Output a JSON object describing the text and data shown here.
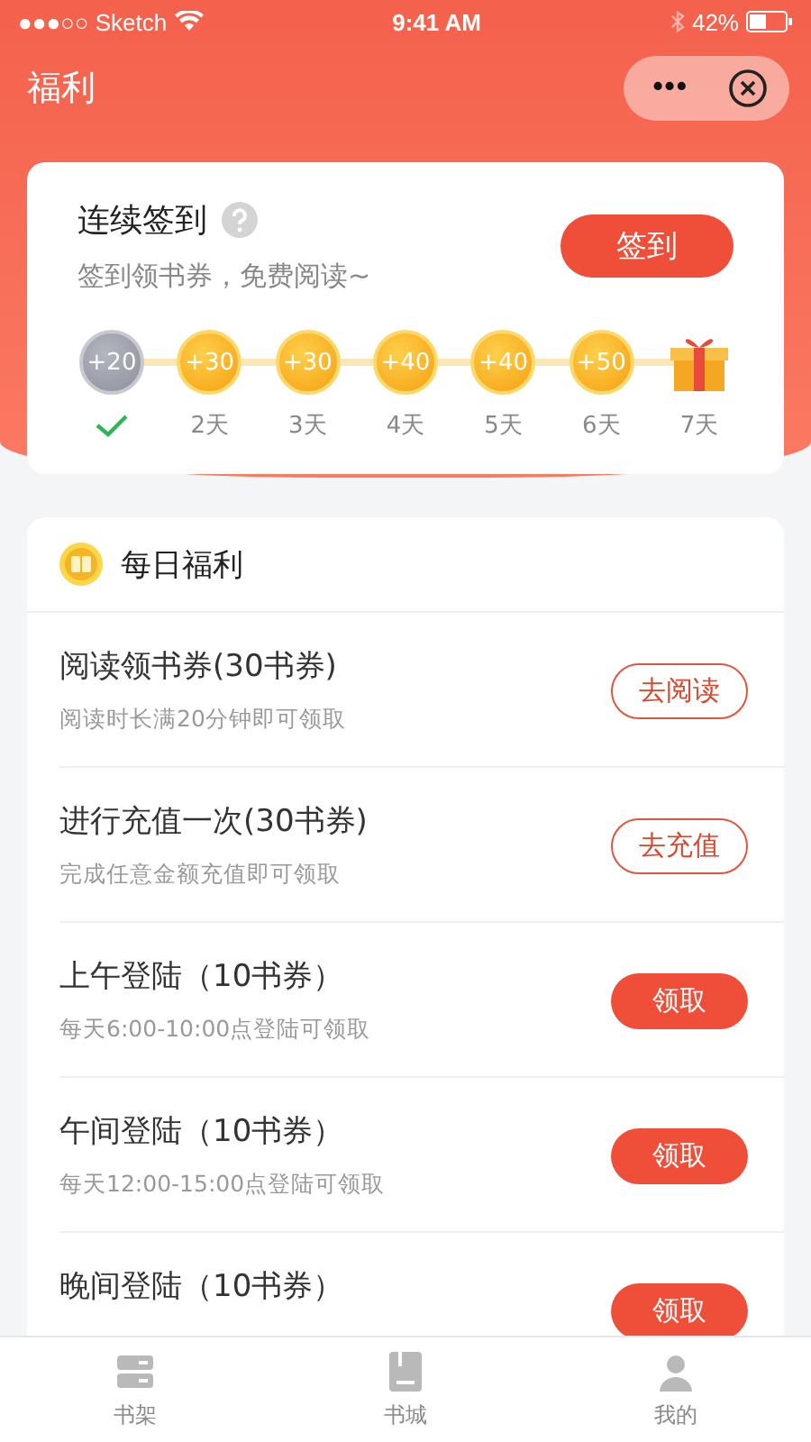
{
  "status_bar": {
    "carrier": "●●●○○ Sketch",
    "time": "9:41 AM",
    "battery": "42%"
  },
  "nav": {
    "title": "福利",
    "more": "•••"
  },
  "checkin": {
    "title": "连续签到",
    "subtitle": "签到领书券，免费阅读~",
    "button": "签到",
    "days": [
      {
        "kind": "coin",
        "amount": "+20",
        "checked": true
      },
      {
        "kind": "coin",
        "amount": "+30",
        "label": "2天",
        "checked": false
      },
      {
        "kind": "coin",
        "amount": "+30",
        "label": "3天",
        "checked": false
      },
      {
        "kind": "coin",
        "amount": "+40",
        "label": "4天",
        "checked": false
      },
      {
        "kind": "coin",
        "amount": "+40",
        "label": "5天",
        "checked": false
      },
      {
        "kind": "coin",
        "amount": "+50",
        "label": "6天",
        "checked": false
      },
      {
        "kind": "gift",
        "label": "7天",
        "checked": false
      }
    ]
  },
  "daily": {
    "title": "每日福利",
    "tasks": [
      {
        "title": "阅读领书券(30书券)",
        "desc": "阅读时长满20分钟即可领取",
        "button": "去阅读",
        "kind": "outline"
      },
      {
        "title": "进行充值一次(30书券)",
        "desc": "完成任意金额充值即可领取",
        "button": "去充值",
        "kind": "outline"
      },
      {
        "title": "上午登陆（10书券）",
        "desc": "每天6:00-10:00点登陆可领取",
        "button": "领取",
        "kind": "filled"
      },
      {
        "title": "午间登陆（10书券）",
        "desc": "每天12:00-15:00点登陆可领取",
        "button": "领取",
        "kind": "filled"
      },
      {
        "title": "晚间登陆（10书券）",
        "button": "领取",
        "kind": "filled"
      }
    ]
  },
  "tabs": [
    {
      "label": "书架",
      "kind": "shelf",
      "selected": false
    },
    {
      "label": "书城",
      "kind": "store",
      "selected": false
    },
    {
      "label": "我的",
      "kind": "profile",
      "selected": false
    }
  ]
}
